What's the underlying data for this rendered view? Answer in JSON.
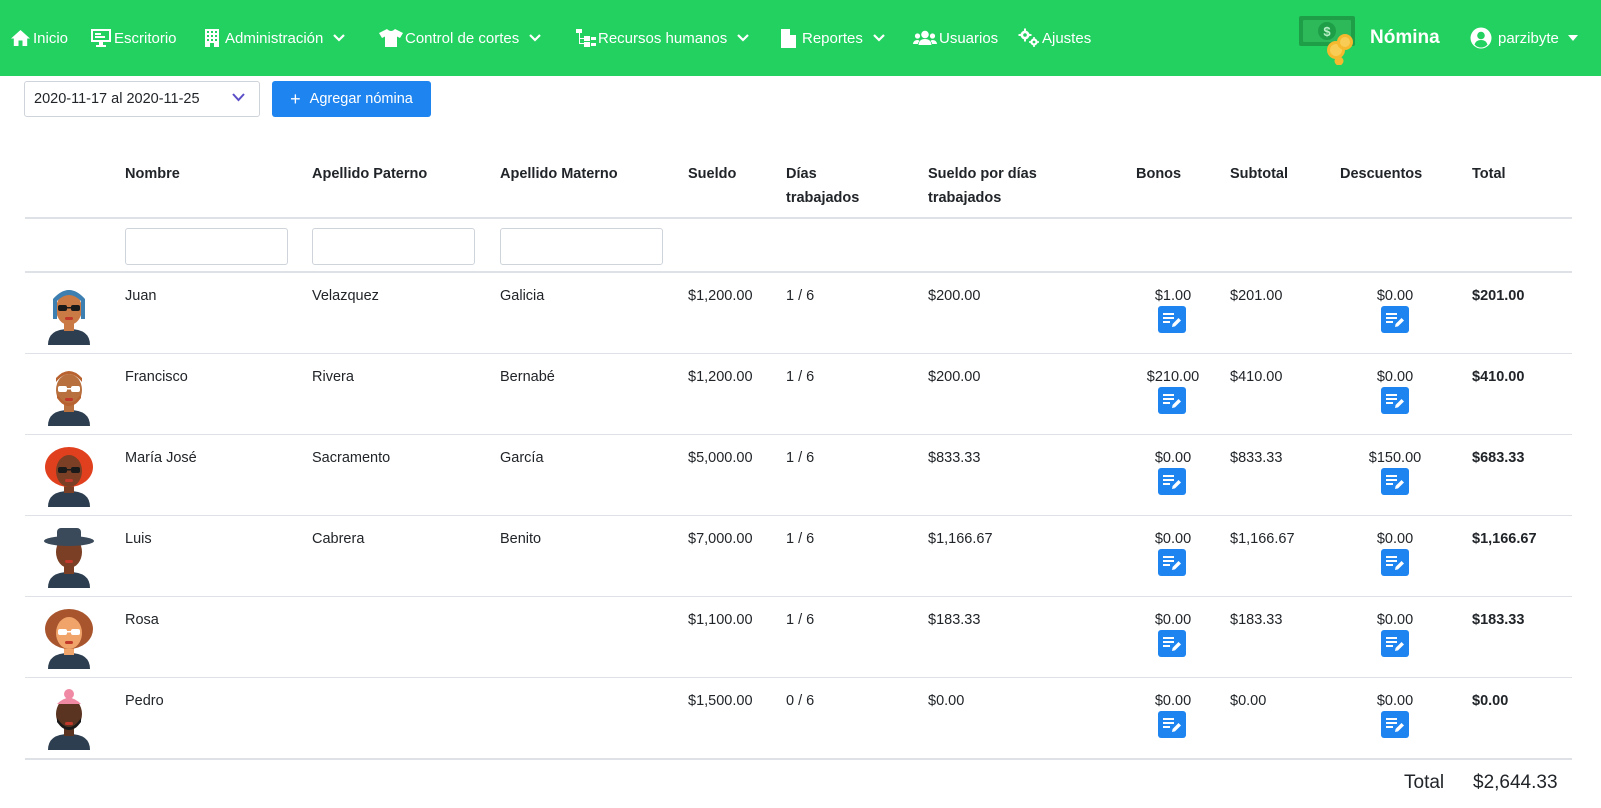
{
  "nav": {
    "items": [
      {
        "label": "Inicio",
        "icon": "home-icon",
        "dropdown": false
      },
      {
        "label": "Escritorio",
        "icon": "desktop-icon",
        "dropdown": false
      },
      {
        "label": "Administración",
        "icon": "building-icon",
        "dropdown": true
      },
      {
        "label": "Control de cortes",
        "icon": "shirt-icon",
        "dropdown": true
      },
      {
        "label": "Recursos humanos",
        "icon": "sitemap-icon",
        "dropdown": true
      },
      {
        "label": "Reportes",
        "icon": "file-icon",
        "dropdown": true
      },
      {
        "label": "Usuarios",
        "icon": "users-icon",
        "dropdown": false
      },
      {
        "label": "Ajustes",
        "icon": "cogs-icon",
        "dropdown": false
      }
    ],
    "brand": "Nómina",
    "user": "parzibyte"
  },
  "controls": {
    "date_range": "2020-11-17 al 2020-11-25",
    "add_button": "Agregar nómina"
  },
  "table": {
    "headers": {
      "nombre": "Nombre",
      "apellido_paterno": "Apellido Paterno",
      "apellido_materno": "Apellido Materno",
      "sueldo": "Sueldo",
      "dias_1": "Días",
      "dias_2": "trabajados",
      "sueldo_dias_1": "Sueldo por días",
      "sueldo_dias_2": "trabajados",
      "bonos": "Bonos",
      "subtotal": "Subtotal",
      "descuentos": "Descuentos",
      "total": "Total"
    },
    "rows": [
      {
        "nombre": "Juan",
        "ap": "Velazquez",
        "am": "Galicia",
        "sueldo": "$1,200.00",
        "dias": "1 / 6",
        "sueldo_dias": "$200.00",
        "bonos": "$1.00",
        "subtotal": "$201.00",
        "descuentos": "$0.00",
        "total": "$201.00"
      },
      {
        "nombre": "Francisco",
        "ap": "Rivera",
        "am": "Bernabé",
        "sueldo": "$1,200.00",
        "dias": "1 / 6",
        "sueldo_dias": "$200.00",
        "bonos": "$210.00",
        "subtotal": "$410.00",
        "descuentos": "$0.00",
        "total": "$410.00"
      },
      {
        "nombre": "María José",
        "ap": "Sacramento",
        "am": "García",
        "sueldo": "$5,000.00",
        "dias": "1 / 6",
        "sueldo_dias": "$833.33",
        "bonos": "$0.00",
        "subtotal": "$833.33",
        "descuentos": "$150.00",
        "total": "$683.33"
      },
      {
        "nombre": "Luis",
        "ap": "Cabrera",
        "am": "Benito",
        "sueldo": "$7,000.00",
        "dias": "1 / 6",
        "sueldo_dias": "$1,166.67",
        "bonos": "$0.00",
        "subtotal": "$1,166.67",
        "descuentos": "$0.00",
        "total": "$1,166.67"
      },
      {
        "nombre": "Rosa",
        "ap": "",
        "am": "",
        "sueldo": "$1,100.00",
        "dias": "1 / 6",
        "sueldo_dias": "$183.33",
        "bonos": "$0.00",
        "subtotal": "$183.33",
        "descuentos": "$0.00",
        "total": "$183.33"
      },
      {
        "nombre": "Pedro",
        "ap": "",
        "am": "",
        "sueldo": "$1,500.00",
        "dias": "0 / 6",
        "sueldo_dias": "$0.00",
        "bonos": "$0.00",
        "subtotal": "$0.00",
        "descuentos": "$0.00",
        "total": "$0.00"
      }
    ],
    "footer": {
      "label": "Total",
      "value": "$2,644.33"
    }
  },
  "colors": {
    "navbar": "#22d160",
    "primary": "#1e84f0"
  }
}
